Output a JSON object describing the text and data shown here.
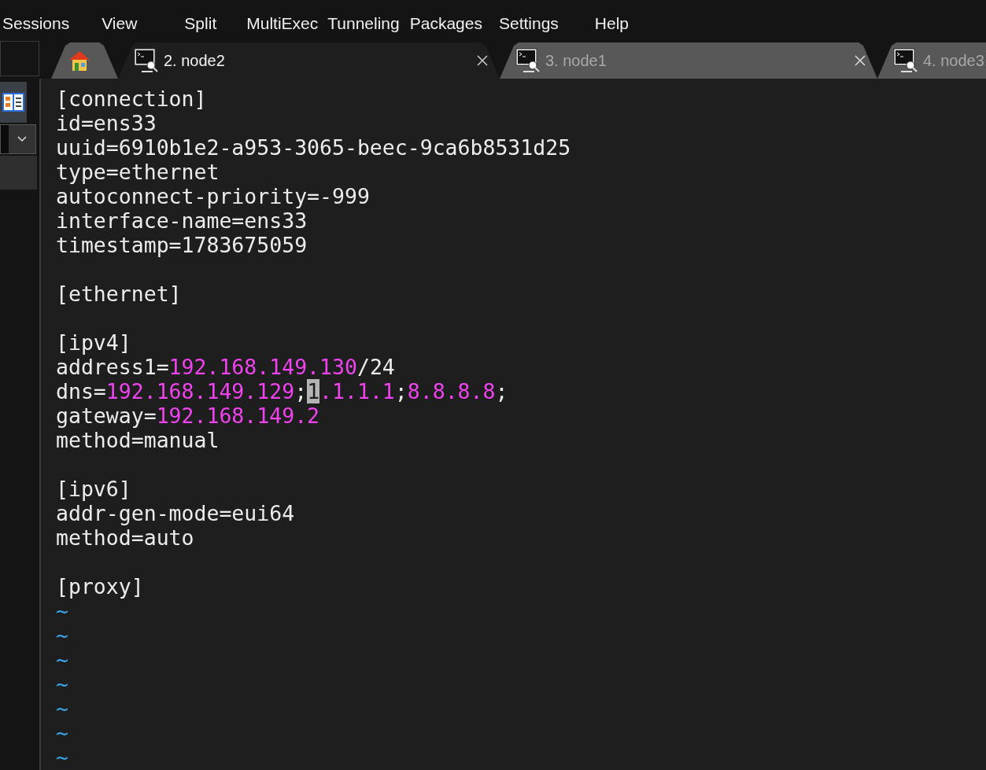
{
  "menu": [
    "Sessions",
    "View",
    "Split",
    "MultiExec",
    "Tunneling",
    "Packages",
    "Settings",
    "Help"
  ],
  "tabs": [
    {
      "kind": "home",
      "selected": false,
      "closable": false
    },
    {
      "kind": "terminal",
      "label": "2. node2",
      "selected": true,
      "closable": true
    },
    {
      "kind": "terminal",
      "label": "3. node1",
      "selected": false,
      "closable": true
    },
    {
      "kind": "terminal",
      "label": "4. node3",
      "selected": false,
      "closable": false
    }
  ],
  "editor": {
    "lines": [
      {
        "kind": "text",
        "segments": [
          {
            "kind": "plain",
            "text": "[connection]"
          }
        ]
      },
      {
        "kind": "text",
        "segments": [
          {
            "kind": "plain",
            "text": "id=ens33"
          }
        ]
      },
      {
        "kind": "text",
        "segments": [
          {
            "kind": "plain",
            "text": "uuid=6910b1e2-a953-3065-beec-9ca6b8531d25"
          }
        ]
      },
      {
        "kind": "text",
        "segments": [
          {
            "kind": "plain",
            "text": "type=ethernet"
          }
        ]
      },
      {
        "kind": "text",
        "segments": [
          {
            "kind": "plain",
            "text": "autoconnect-priority=-999"
          }
        ]
      },
      {
        "kind": "text",
        "segments": [
          {
            "kind": "plain",
            "text": "interface-name=ens33"
          }
        ]
      },
      {
        "kind": "text",
        "segments": [
          {
            "kind": "plain",
            "text": "timestamp=1783675059"
          }
        ]
      },
      {
        "kind": "blank"
      },
      {
        "kind": "text",
        "segments": [
          {
            "kind": "plain",
            "text": "[ethernet]"
          }
        ]
      },
      {
        "kind": "blank"
      },
      {
        "kind": "text",
        "segments": [
          {
            "kind": "plain",
            "text": "[ipv4]"
          }
        ]
      },
      {
        "kind": "text",
        "segments": [
          {
            "kind": "plain",
            "text": "address1="
          },
          {
            "kind": "ip",
            "text": "192.168.149.130"
          },
          {
            "kind": "plain",
            "text": "/24"
          }
        ]
      },
      {
        "kind": "text",
        "segments": [
          {
            "kind": "plain",
            "text": "dns="
          },
          {
            "kind": "ip",
            "text": "192.168.149.129"
          },
          {
            "kind": "plain",
            "text": ";"
          },
          {
            "kind": "cursor",
            "text": "1"
          },
          {
            "kind": "ip",
            "text": ".1.1.1"
          },
          {
            "kind": "plain",
            "text": ";"
          },
          {
            "kind": "ip",
            "text": "8.8.8.8"
          },
          {
            "kind": "plain",
            "text": ";"
          }
        ]
      },
      {
        "kind": "text",
        "segments": [
          {
            "kind": "plain",
            "text": "gateway="
          },
          {
            "kind": "ip",
            "text": "192.168.149.2"
          }
        ]
      },
      {
        "kind": "text",
        "segments": [
          {
            "kind": "plain",
            "text": "method=manual"
          }
        ]
      },
      {
        "kind": "blank"
      },
      {
        "kind": "text",
        "segments": [
          {
            "kind": "plain",
            "text": "[ipv6]"
          }
        ]
      },
      {
        "kind": "text",
        "segments": [
          {
            "kind": "plain",
            "text": "addr-gen-mode=eui64"
          }
        ]
      },
      {
        "kind": "text",
        "segments": [
          {
            "kind": "plain",
            "text": "method=auto"
          }
        ]
      },
      {
        "kind": "blank"
      },
      {
        "kind": "text",
        "segments": [
          {
            "kind": "plain",
            "text": "[proxy]"
          }
        ]
      },
      {
        "kind": "tilde",
        "text": "~"
      },
      {
        "kind": "tilde",
        "text": "~"
      },
      {
        "kind": "tilde",
        "text": "~"
      },
      {
        "kind": "tilde",
        "text": "~"
      },
      {
        "kind": "tilde",
        "text": "~"
      },
      {
        "kind": "tilde",
        "text": "~"
      },
      {
        "kind": "tilde",
        "text": "~"
      }
    ]
  }
}
